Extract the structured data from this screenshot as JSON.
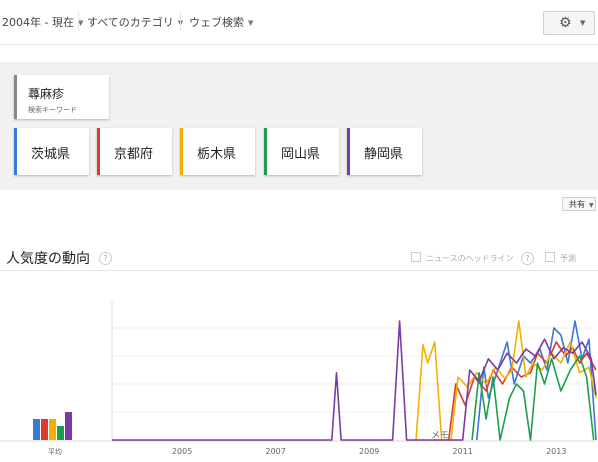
{
  "toolbar": {
    "time": "2004年 - 現在",
    "category": "すべてのカテゴリ",
    "search_type": "ウェブ検索"
  },
  "keyword": {
    "term": "蕁麻疹",
    "subtitle": "検索キーワード"
  },
  "regions": [
    {
      "label": "茨城県",
      "color": "#3a78d8"
    },
    {
      "label": "京都府",
      "color": "#dc3a2d"
    },
    {
      "label": "栃木県",
      "color": "#f2b100"
    },
    {
      "label": "岡山県",
      "color": "#1e9e4d"
    },
    {
      "label": "静岡県",
      "color": "#7d3aa6"
    }
  ],
  "share_label": "共有",
  "trend": {
    "title": "人気度の動向",
    "help": "?",
    "news_label": "ニュースのヘッドライン",
    "forecast_label": "予測"
  },
  "chart_data": {
    "type": "line",
    "xlabel": "",
    "ylabel": "",
    "x_ticks": [
      "2005",
      "2007",
      "2009",
      "2011",
      "2013"
    ],
    "average_label": "平均",
    "note_label": "メモ",
    "ylim": [
      0,
      100
    ],
    "averages": [
      {
        "name": "茨城県",
        "value": 15
      },
      {
        "name": "京都府",
        "value": 15
      },
      {
        "name": "栃木県",
        "value": 15
      },
      {
        "name": "岡山県",
        "value": 10
      },
      {
        "name": "静岡県",
        "value": 20
      }
    ],
    "series": [
      {
        "name": "茨城県",
        "color": "#3a78d8",
        "values": [
          [
            2011.8,
            0
          ],
          [
            2011.95,
            52
          ],
          [
            2012.05,
            30
          ],
          [
            2012.25,
            50
          ],
          [
            2012.45,
            70
          ],
          [
            2012.6,
            40
          ],
          [
            2012.8,
            60
          ],
          [
            2012.95,
            55
          ],
          [
            2013.15,
            65
          ],
          [
            2013.3,
            50
          ],
          [
            2013.45,
            80
          ],
          [
            2013.6,
            75
          ],
          [
            2013.75,
            55
          ],
          [
            2013.9,
            85
          ],
          [
            2014.05,
            58
          ],
          [
            2014.2,
            72
          ],
          [
            2014.35,
            0
          ]
        ]
      },
      {
        "name": "京都府",
        "color": "#dc3a2d",
        "values": [
          [
            2011.2,
            0
          ],
          [
            2011.35,
            40
          ],
          [
            2011.55,
            25
          ],
          [
            2011.75,
            45
          ],
          [
            2012.0,
            35
          ],
          [
            2012.15,
            50
          ],
          [
            2012.35,
            40
          ],
          [
            2012.55,
            52
          ],
          [
            2012.75,
            45
          ],
          [
            2012.95,
            48
          ],
          [
            2013.1,
            62
          ],
          [
            2013.3,
            55
          ],
          [
            2013.5,
            70
          ],
          [
            2013.7,
            60
          ],
          [
            2013.85,
            66
          ],
          [
            2014.0,
            55
          ],
          [
            2014.15,
            62
          ],
          [
            2014.35,
            50
          ]
        ]
      },
      {
        "name": "栃木県",
        "color": "#f2b100",
        "values": [
          [
            2010.5,
            0
          ],
          [
            2010.65,
            68
          ],
          [
            2010.75,
            55
          ],
          [
            2010.9,
            70
          ],
          [
            2011.05,
            0
          ],
          [
            2011.25,
            0
          ],
          [
            2011.4,
            45
          ],
          [
            2011.6,
            38
          ],
          [
            2011.8,
            48
          ],
          [
            2012.0,
            40
          ],
          [
            2012.2,
            52
          ],
          [
            2012.4,
            44
          ],
          [
            2012.55,
            50
          ],
          [
            2012.7,
            85
          ],
          [
            2012.85,
            45
          ],
          [
            2013.0,
            55
          ],
          [
            2013.2,
            50
          ],
          [
            2013.4,
            62
          ],
          [
            2013.6,
            55
          ],
          [
            2013.8,
            70
          ],
          [
            2014.0,
            48
          ],
          [
            2014.2,
            52
          ],
          [
            2014.35,
            30
          ]
        ]
      },
      {
        "name": "岡山県",
        "color": "#1e9e4d",
        "values": [
          [
            2011.7,
            0
          ],
          [
            2011.85,
            48
          ],
          [
            2012.0,
            15
          ],
          [
            2012.15,
            45
          ],
          [
            2012.3,
            0
          ],
          [
            2012.5,
            30
          ],
          [
            2012.65,
            40
          ],
          [
            2012.8,
            35
          ],
          [
            2012.95,
            0
          ],
          [
            2013.1,
            55
          ],
          [
            2013.25,
            40
          ],
          [
            2013.4,
            58
          ],
          [
            2013.6,
            35
          ],
          [
            2013.8,
            50
          ],
          [
            2014.0,
            60
          ],
          [
            2014.15,
            45
          ],
          [
            2014.3,
            0
          ]
        ]
      },
      {
        "name": "静岡県",
        "color": "#7d3aa6",
        "values": [
          [
            2004.0,
            0
          ],
          [
            2008.7,
            0
          ],
          [
            2008.8,
            48
          ],
          [
            2008.9,
            0
          ],
          [
            2010.0,
            0
          ],
          [
            2010.15,
            85
          ],
          [
            2010.3,
            0
          ],
          [
            2011.5,
            0
          ],
          [
            2011.65,
            50
          ],
          [
            2011.85,
            42
          ],
          [
            2012.05,
            58
          ],
          [
            2012.25,
            50
          ],
          [
            2012.45,
            62
          ],
          [
            2012.65,
            55
          ],
          [
            2012.85,
            65
          ],
          [
            2013.05,
            60
          ],
          [
            2013.25,
            72
          ],
          [
            2013.45,
            58
          ],
          [
            2013.65,
            66
          ],
          [
            2013.85,
            62
          ],
          [
            2014.05,
            70
          ],
          [
            2014.25,
            58
          ],
          [
            2014.35,
            32
          ]
        ]
      }
    ]
  }
}
